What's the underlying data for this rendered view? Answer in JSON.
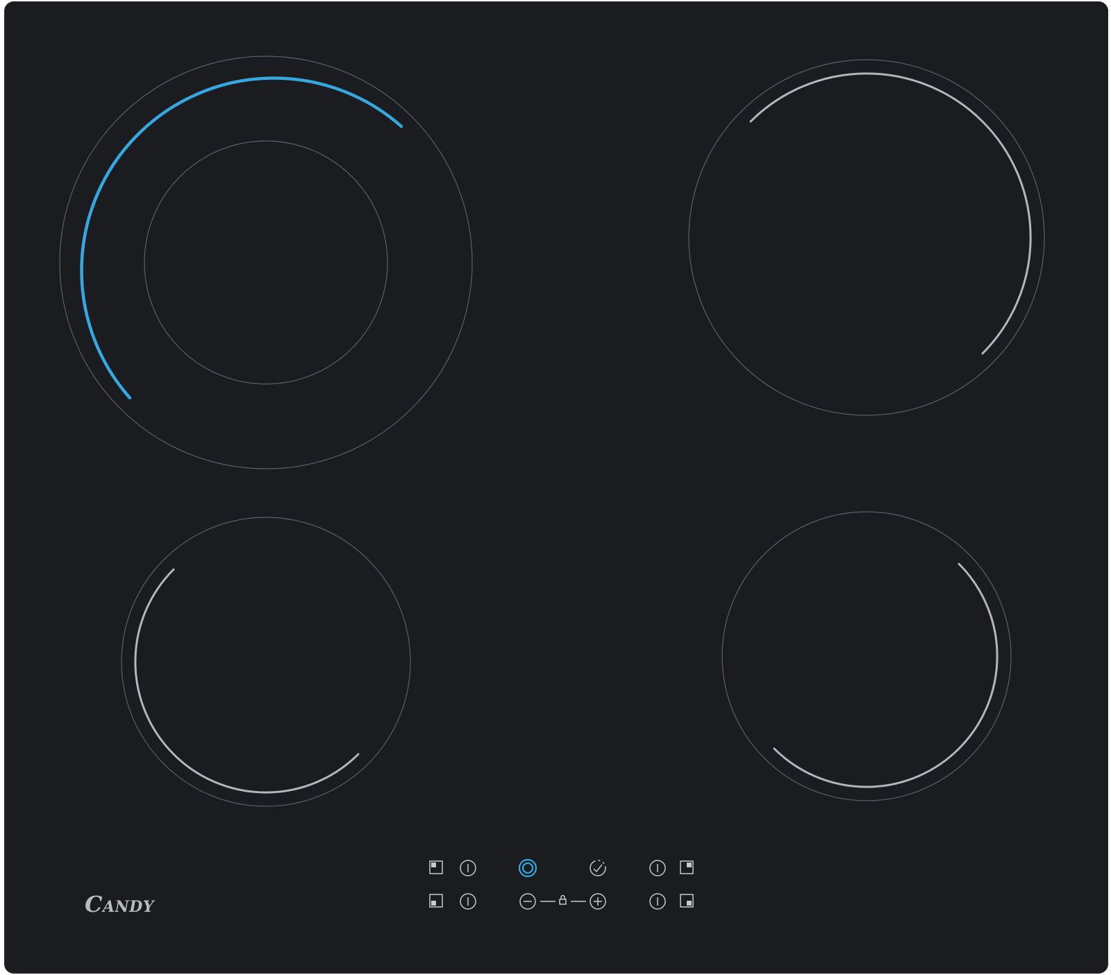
{
  "brand": {
    "logo_text": "CANDY"
  },
  "colors": {
    "glass": "#1b1c20",
    "active_indicator": "#36a8e0",
    "zone_marking": "#b4b6bb",
    "control_marking": "#c7c8cc"
  },
  "cooking_zones": [
    {
      "id": "rear-left",
      "size": "large",
      "dual_ring": true,
      "active": true
    },
    {
      "id": "rear-right",
      "size": "large",
      "dual_ring": false,
      "active": false
    },
    {
      "id": "front-left",
      "size": "medium",
      "dual_ring": false,
      "active": false
    },
    {
      "id": "front-right",
      "size": "medium",
      "dual_ring": false,
      "active": false
    }
  ],
  "controls": {
    "zone_select_icons": [
      "zone-rear-left-icon",
      "zone-front-left-icon",
      "zone-rear-right-icon",
      "zone-front-right-icon"
    ],
    "power_button_icon": "power-ring-icon",
    "power_button_lit": true,
    "timer_icon": "timer-icon",
    "minus_icon": "minus-icon",
    "plus_icon": "plus-icon",
    "lock_icon": "lock-icon"
  }
}
